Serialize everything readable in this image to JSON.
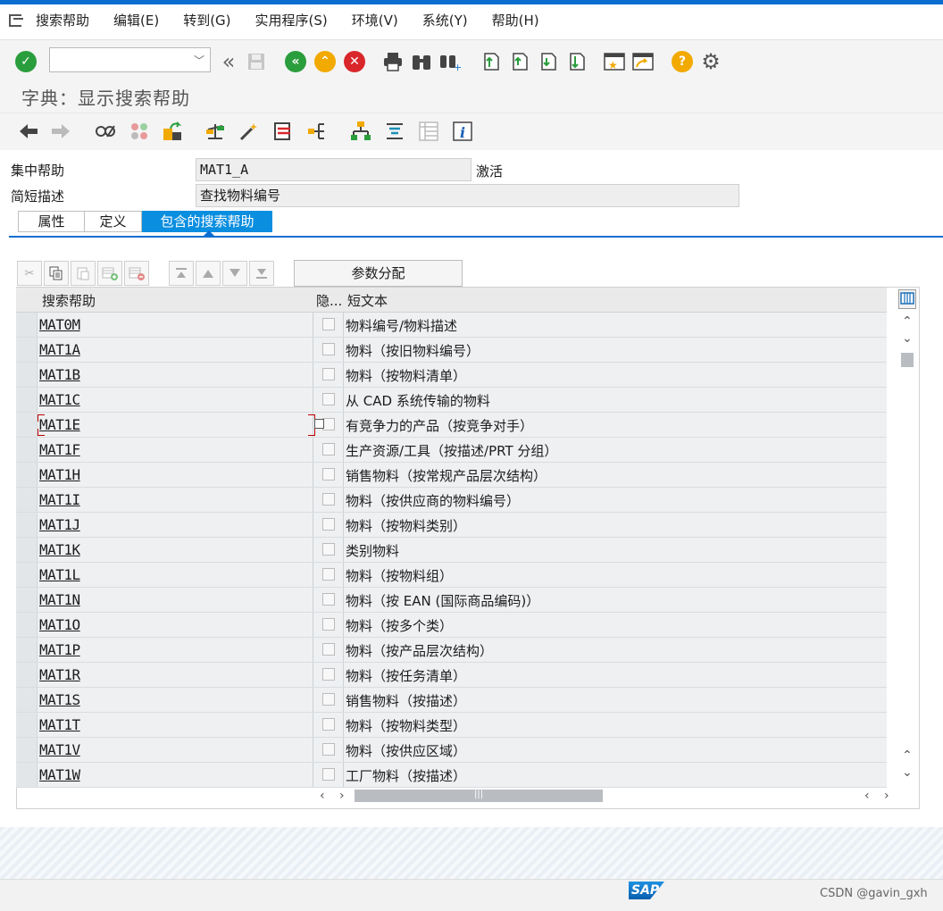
{
  "menu": {
    "items": [
      "搜索帮助",
      "编辑(E)",
      "转到(G)",
      "实用程序(S)",
      "环境(V)",
      "系统(Y)",
      "帮助(H)"
    ]
  },
  "toolbar": {
    "command_value": ""
  },
  "title": "字典：显示搜索帮助",
  "header": {
    "collective_label": "集中帮助",
    "collective_value": "MAT1_A",
    "status": "激活",
    "short_desc_label": "简短描述",
    "short_desc_value": "查找物料编号"
  },
  "tabs": [
    "属性",
    "定义",
    "包含的搜索帮助"
  ],
  "param_button": "参数分配",
  "table": {
    "columns": [
      "搜索帮助",
      "隐...",
      "短文本"
    ],
    "rows": [
      {
        "name": "MAT0M",
        "text": "物料编号/物料描述"
      },
      {
        "name": "MAT1A",
        "text": "物料（按旧物料编号）"
      },
      {
        "name": "MAT1B",
        "text": "物料（按物料清单）"
      },
      {
        "name": "MAT1C",
        "text": "从 CAD 系统传输的物料"
      },
      {
        "name": "MAT1E",
        "text": "有竞争力的产品（按竞争对手）"
      },
      {
        "name": "MAT1F",
        "text": "生产资源/工具（按描述/PRT 分组）"
      },
      {
        "name": "MAT1H",
        "text": "销售物料（按常规产品层次结构）"
      },
      {
        "name": "MAT1I",
        "text": "物料（按供应商的物料编号）"
      },
      {
        "name": "MAT1J",
        "text": "物料（按物料类别）"
      },
      {
        "name": "MAT1K",
        "text": "类别物料"
      },
      {
        "name": "MAT1L",
        "text": "物料（按物料组）"
      },
      {
        "name": "MAT1N",
        "text": "物料（按 EAN (国际商品编码)）"
      },
      {
        "name": "MAT1O",
        "text": "物料（按多个类）"
      },
      {
        "name": "MAT1P",
        "text": "物料（按产品层次结构）"
      },
      {
        "name": "MAT1R",
        "text": "物料（按任务清单）"
      },
      {
        "name": "MAT1S",
        "text": "销售物料（按描述）"
      },
      {
        "name": "MAT1T",
        "text": "物料（按物料类型）"
      },
      {
        "name": "MAT1V",
        "text": "物料（按供应区域）"
      },
      {
        "name": "MAT1W",
        "text": "工厂物料（按描述）"
      }
    ]
  },
  "footer": {
    "logo_text": "SAP",
    "watermark": "CSDN @gavin_gxh"
  }
}
